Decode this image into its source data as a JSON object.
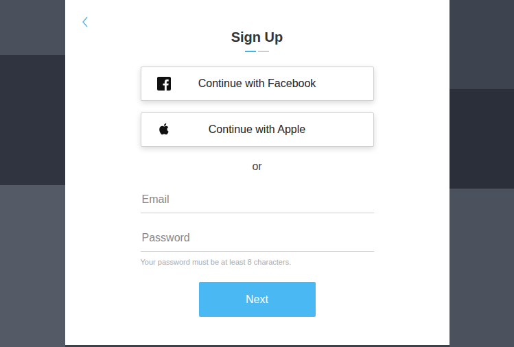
{
  "title": "Sign Up",
  "progress": [
    {
      "selected": true
    },
    {
      "selected": false
    }
  ],
  "social_buttons": [
    {
      "label": "Continue with Facebook",
      "kind": "facebook"
    },
    {
      "label": "Continue with Apple",
      "kind": "apple"
    }
  ],
  "divider": "or",
  "fields": [
    {
      "placeholder": "Email",
      "kind": "email"
    },
    {
      "placeholder": "Password",
      "kind": "password"
    }
  ],
  "hint": "Your password must be at least 8 characters.",
  "buttons": [
    "Next"
  ]
}
